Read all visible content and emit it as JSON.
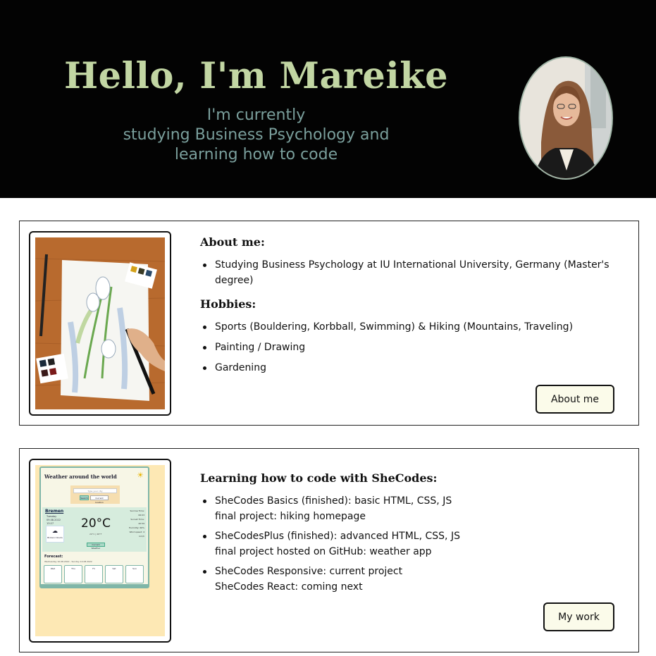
{
  "header": {
    "title": "Hello, I'm Mareike",
    "subtitle_lines": [
      "I'm currently",
      "studying Business Psychology and",
      "learning how to code"
    ]
  },
  "about_card": {
    "heading_about": "About me:",
    "about_items": [
      "Studying Business Psychology at IU International University, Germany (Master's degree)"
    ],
    "heading_hobbies": "Hobbies:",
    "hobby_items": [
      "Sports (Bouldering, Korbball, Swimming) & Hiking (Mountains, Traveling)",
      "Painting / Drawing",
      "Gardening"
    ],
    "button_label": "About me"
  },
  "coding_card": {
    "heading": "Learning how to code with SheCodes:",
    "items": [
      {
        "line1": "SheCodes Basics (finished): basic HTML, CSS, JS",
        "line2": "final project: hiking homepage"
      },
      {
        "line1": "SheCodesPlus (finished): advanced HTML, CSS, JS",
        "line2": "final project hosted on GitHub: weather app"
      },
      {
        "line1": "SheCodes Responsive: current project",
        "line2": "SheCodes React: coming next"
      }
    ],
    "button_label": "My work"
  },
  "weather_preview": {
    "title": "Weather around the world",
    "search_placeholder": "Type your city",
    "search_button": "Search",
    "current_button": "Current location",
    "city": "Bremen",
    "date_lines": [
      "Tuesday",
      "09.08.2022",
      "13:27"
    ],
    "description": "Broken Clouds",
    "temperature": "20°C",
    "unit_toggle": "20°C | 68°F",
    "location_button": "Current Weather",
    "side_info": [
      "Sunrise Time: 06:03",
      "Sunset Time: 20:59",
      "Humidity: 66%",
      "Wind speed: 4 km/h"
    ],
    "forecast_label": "Forecast:",
    "forecast_range": "Wednesday 10.08.2022 - Sunday 14.08.2022",
    "forecast_days": [
      "Wed",
      "Thu",
      "Fri",
      "Sat",
      "Sun"
    ]
  },
  "colors": {
    "header_bg": "#030303",
    "title_color": "#c2d6a3",
    "subtitle_color": "#7a9f9c",
    "button_bg": "#fbfbea"
  }
}
